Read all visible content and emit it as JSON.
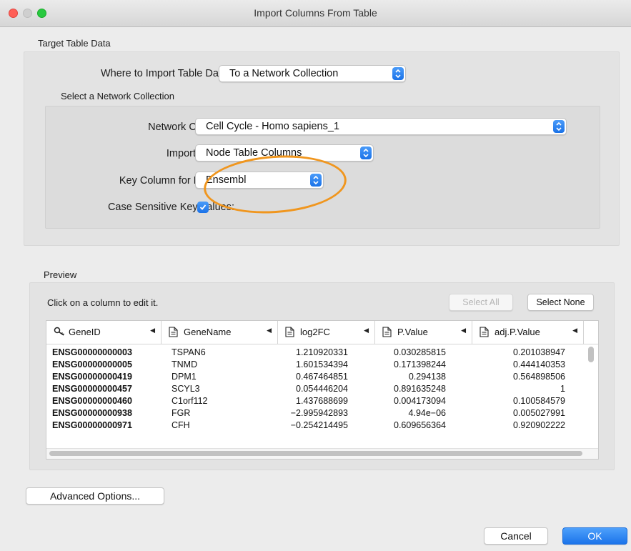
{
  "window": {
    "title": "Import Columns From Table"
  },
  "target_section": {
    "title": "Target Table Data",
    "where_label": "Where to Import Table Data",
    "where_value": "To a Network Collection",
    "select_collection_title": "Select a Network Collection",
    "network_collection_label": "Network Collection",
    "network_collection_value": "Cell Cycle - Homo sapiens_1",
    "import_as_label": "Import Data as",
    "import_as_value": "Node Table Columns",
    "key_column_label": "Key Column for Network:",
    "key_column_value": "Ensembl",
    "case_sensitive_label": "Case Sensitive Key Values:",
    "case_sensitive_checked": true
  },
  "preview": {
    "title": "Preview",
    "hint": "Click on a column to edit it.",
    "select_all_label": "Select All",
    "select_none_label": "Select None",
    "columns": [
      {
        "name": "GeneID",
        "icon": "key-icon"
      },
      {
        "name": "GeneName",
        "icon": "document-icon"
      },
      {
        "name": "log2FC",
        "icon": "document-icon"
      },
      {
        "name": "P.Value",
        "icon": "document-icon"
      },
      {
        "name": "adj.P.Value",
        "icon": "document-icon"
      }
    ],
    "rows": [
      [
        "ENSG00000000003",
        "TSPAN6",
        "1.210920331",
        "0.030285815",
        "0.201038947"
      ],
      [
        "ENSG00000000005",
        "TNMD",
        "1.601534394",
        "0.171398244",
        "0.444140353"
      ],
      [
        "ENSG00000000419",
        "DPM1",
        "0.467464851",
        "0.294138",
        "0.564898506"
      ],
      [
        "ENSG00000000457",
        "SCYL3",
        "0.054446204",
        "0.891635248",
        "1"
      ],
      [
        "ENSG00000000460",
        "C1orf112",
        "1.437688699",
        "0.004173094",
        "0.100584579"
      ],
      [
        "ENSG00000000938",
        "FGR",
        "−2.995942893",
        "4.94e−06",
        "0.005027991"
      ],
      [
        "ENSG00000000971",
        "CFH",
        "−0.254214495",
        "0.609656364",
        "0.920902222"
      ]
    ]
  },
  "footer": {
    "advanced_label": "Advanced Options...",
    "cancel_label": "Cancel",
    "ok_label": "OK"
  },
  "colors": {
    "accent": "#1c74ea",
    "annotation": "#f0961e"
  }
}
